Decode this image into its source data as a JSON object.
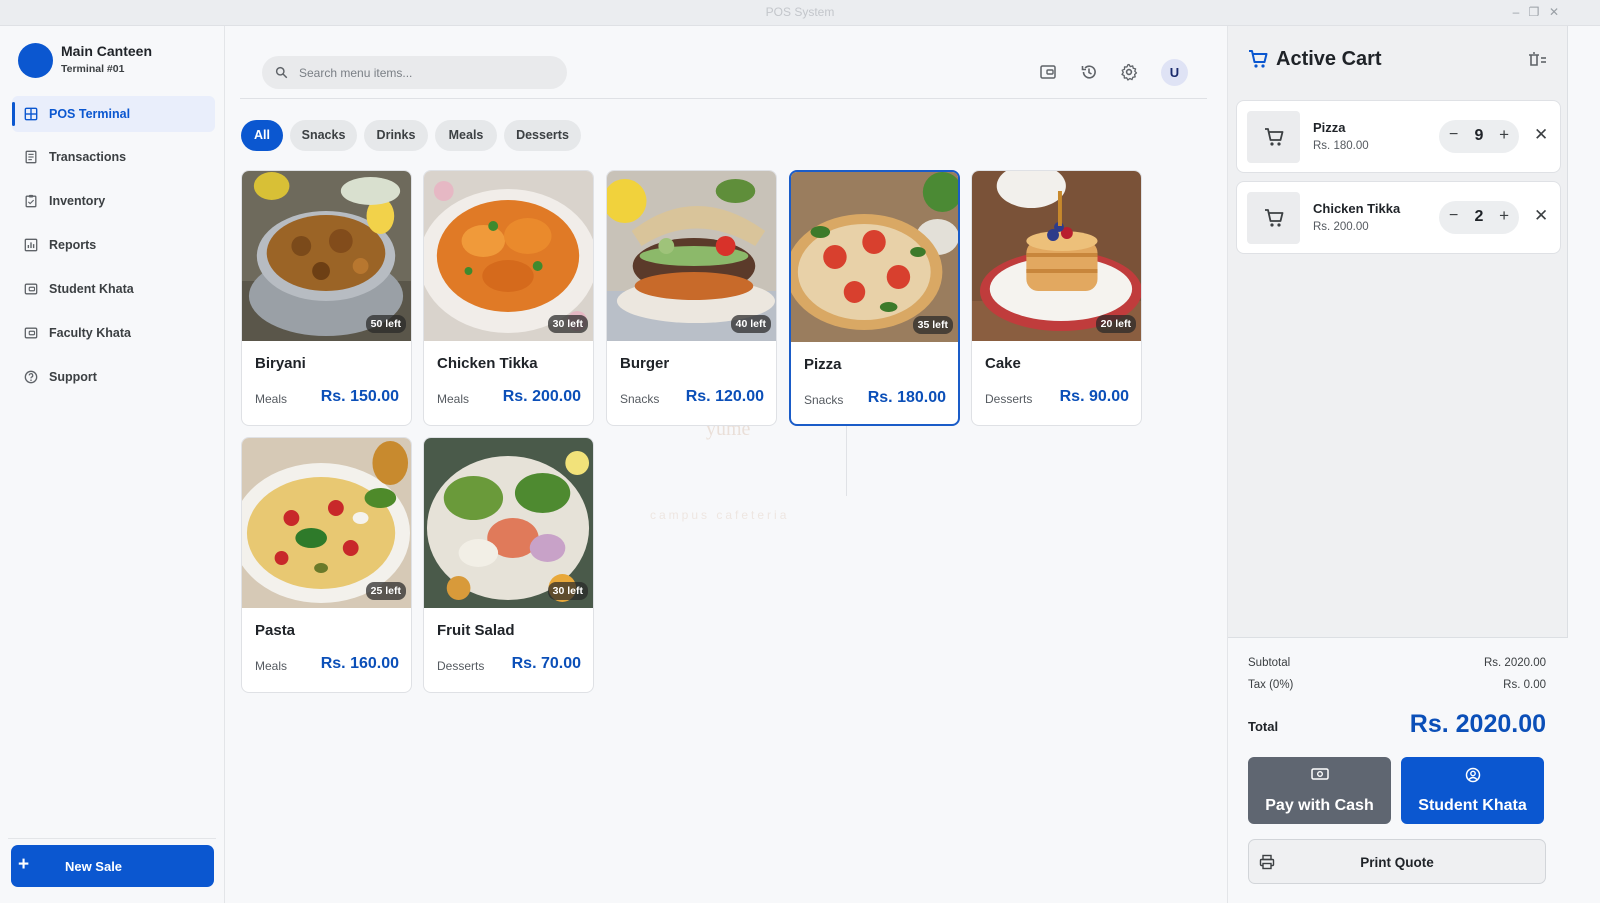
{
  "window": {
    "title": "POS System"
  },
  "colors": {
    "primary": "#0b57d0",
    "price": "#0b4fb8",
    "pay_cash": "#5f6671",
    "background": "#f7f8fa"
  },
  "sidebar": {
    "brand_name": "Main Canteen",
    "brand_sub": "Terminal #01",
    "items": [
      {
        "label": "POS Terminal",
        "icon": "grid-icon",
        "active": true
      },
      {
        "label": "Transactions",
        "icon": "receipt-icon"
      },
      {
        "label": "Inventory",
        "icon": "clipboard-icon"
      },
      {
        "label": "Reports",
        "icon": "chart-icon"
      },
      {
        "label": "Student Khata",
        "icon": "wallet-icon"
      },
      {
        "label": "Faculty Khata",
        "icon": "wallet-icon"
      },
      {
        "label": "Support",
        "icon": "help-icon"
      }
    ],
    "new_sale_label": "New Sale"
  },
  "header": {
    "search_placeholder": "Search menu items...",
    "icons": [
      "wallet-icon",
      "history-icon",
      "settings-icon"
    ],
    "user_initial": "U"
  },
  "filters": {
    "options": [
      "All",
      "Snacks",
      "Drinks",
      "Meals",
      "Desserts"
    ],
    "selected": "All"
  },
  "watermark": {
    "brand": "yume",
    "tagline": "campus cafeteria"
  },
  "menu": {
    "items": [
      {
        "name": "Biryani",
        "category": "Meals",
        "price": "Rs. 150.00",
        "stock": "50 left"
      },
      {
        "name": "Chicken Tikka",
        "category": "Meals",
        "price": "Rs. 200.00",
        "stock": "30 left"
      },
      {
        "name": "Burger",
        "category": "Snacks",
        "price": "Rs. 120.00",
        "stock": "40 left"
      },
      {
        "name": "Pizza",
        "category": "Snacks",
        "price": "Rs. 180.00",
        "stock": "35 left",
        "selected": true
      },
      {
        "name": "Cake",
        "category": "Desserts",
        "price": "Rs. 90.00",
        "stock": "20 left"
      },
      {
        "name": "Pasta",
        "category": "Meals",
        "price": "Rs. 160.00",
        "stock": "25 left"
      },
      {
        "name": "Fruit Salad",
        "category": "Desserts",
        "price": "Rs. 70.00",
        "stock": "30 left"
      }
    ]
  },
  "cart": {
    "title": "Active Cart",
    "items": [
      {
        "name": "Pizza",
        "price": "Rs. 180.00",
        "qty": "9"
      },
      {
        "name": "Chicken Tikka",
        "price": "Rs. 200.00",
        "qty": "2"
      }
    ],
    "subtotal_label": "Subtotal",
    "subtotal": "Rs. 2020.00",
    "tax_label": "Tax (0%)",
    "tax": "Rs. 0.00",
    "total_label": "Total",
    "total": "Rs. 2020.00",
    "pay_cash_label": "Pay with Cash",
    "student_khata_label": "Student Khata",
    "print_quote_label": "Print Quote"
  }
}
